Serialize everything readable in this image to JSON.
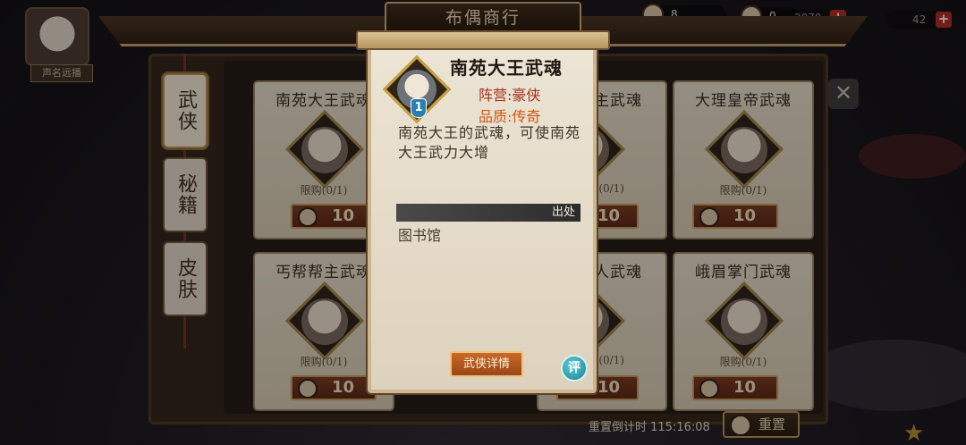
{
  "shop": {
    "title": "布偶商行",
    "reset_countdown": "重置倒计时 115:16:08",
    "reset_button": "重置"
  },
  "hud": {
    "resource_1": "8",
    "resource_2": "0",
    "resource_3": "2970",
    "resource_4": "42"
  },
  "left": {
    "reputation_label": "声名远播"
  },
  "tabs": [
    {
      "label": "武侠",
      "active": true
    },
    {
      "label": "秘籍",
      "active": false
    },
    {
      "label": "皮肤",
      "active": false
    }
  ],
  "items": [
    {
      "name": "南苑大王武魂",
      "limit": "限购(0/1)",
      "price": "10"
    },
    {
      "name": "主武魂",
      "limit": "(0/1)",
      "price": "10"
    },
    {
      "name": "大理皇帝武魂",
      "limit": "限购(0/1)",
      "price": "10"
    },
    {
      "name": "丐帮帮主武魂",
      "limit": "限购(0/1)",
      "price": "10"
    },
    {
      "name": "人武魂",
      "limit": "(0/1)",
      "price": "10"
    },
    {
      "name": "峨眉掌门武魂",
      "limit": "限购(0/1)",
      "price": "10"
    }
  ],
  "popup": {
    "title": "南苑大王武魂",
    "level": "1",
    "faction": "阵营:豪侠",
    "quality": "品质:传奇",
    "description": "南苑大王的武魂，可使南苑大王武力大增",
    "source_label": "出处",
    "source_value": "图书馆",
    "detail_button": "武侠详情",
    "share_button": "评"
  },
  "colors": {
    "faction": "#a2331f",
    "quality": "#cf5a12",
    "detail_button": "#c86a28"
  }
}
